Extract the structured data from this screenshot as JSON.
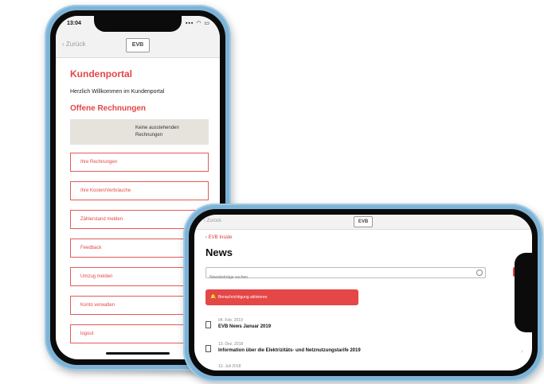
{
  "portrait": {
    "status": {
      "time": "13:04",
      "icons": "▪▪▪ ◠ ▭"
    },
    "nav": {
      "back_label": "‹ Zurück",
      "logo_text": "EVB"
    },
    "heading": "Kundenportal",
    "welcome": "Herzlich Willkommen im Kundenportal",
    "open_invoices_heading": "Offene Rechnungen",
    "open_invoices_text": "Keine ausstehenden Rechnungen",
    "menu_items": [
      "Ihre Rechnungen",
      "Ihre Kosten/Verbräuche",
      "Zählerstand melden",
      "Feedback",
      "Umzug melden",
      "Konto verwalten",
      "logout"
    ]
  },
  "landscape": {
    "topbar": {
      "back_label": "‹ Zurück",
      "logo_text": "EVB"
    },
    "back_link": "‹ EVB Inside",
    "title": "News",
    "search_placeholder": "Newsbeiträge suchen",
    "notify_button": "Benachrichtigung aktivieren",
    "news": [
      {
        "date": "04. Feb. 2019",
        "title": "EVB News Januar 2019"
      },
      {
        "date": "13. Dez. 2018",
        "title": "Information über die Elektrizitäts- und Netznutzungstarife 2019"
      },
      {
        "date": "13. Juli 2018",
        "title": ""
      }
    ]
  },
  "colors": {
    "accent": "#e54646",
    "frame": "#7eb3d6"
  }
}
